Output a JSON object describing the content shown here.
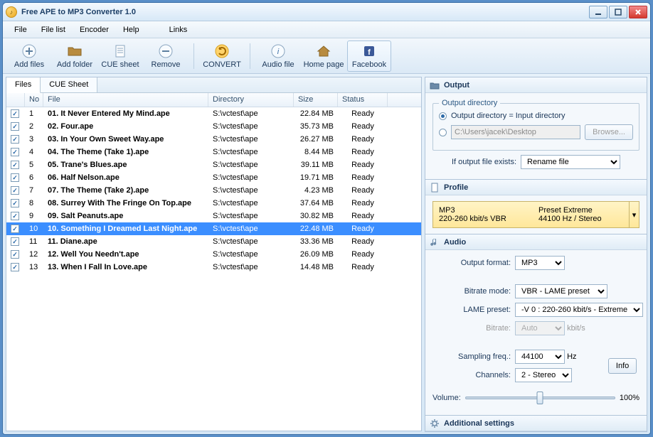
{
  "window": {
    "title": "Free APE to MP3 Converter 1.0"
  },
  "menubar": {
    "items": [
      "File",
      "File list",
      "Encoder",
      "Help"
    ],
    "right": [
      "Links"
    ]
  },
  "toolbar": {
    "add_files": "Add files",
    "add_folder": "Add folder",
    "cue_sheet": "CUE sheet",
    "remove": "Remove",
    "convert": "CONVERT",
    "audio_file": "Audio file",
    "home_page": "Home page",
    "facebook": "Facebook"
  },
  "tabs": {
    "files": "Files",
    "cue": "CUE Sheet"
  },
  "columns": {
    "no": "No",
    "file": "File",
    "dir": "Directory",
    "size": "Size",
    "status": "Status"
  },
  "rows": [
    {
      "no": "1",
      "file": "01. It Never Entered My Mind.ape",
      "dir": "S:\\vctest\\ape",
      "size": "22.84 MB",
      "status": "Ready",
      "chk": true,
      "sel": false
    },
    {
      "no": "2",
      "file": "02. Four.ape",
      "dir": "S:\\vctest\\ape",
      "size": "35.73 MB",
      "status": "Ready",
      "chk": true,
      "sel": false
    },
    {
      "no": "3",
      "file": "03. In Your Own Sweet Way.ape",
      "dir": "S:\\vctest\\ape",
      "size": "26.27 MB",
      "status": "Ready",
      "chk": true,
      "sel": false
    },
    {
      "no": "4",
      "file": "04. The Theme (Take 1).ape",
      "dir": "S:\\vctest\\ape",
      "size": "8.44 MB",
      "status": "Ready",
      "chk": true,
      "sel": false
    },
    {
      "no": "5",
      "file": "05. Trane's Blues.ape",
      "dir": "S:\\vctest\\ape",
      "size": "39.11 MB",
      "status": "Ready",
      "chk": true,
      "sel": false
    },
    {
      "no": "6",
      "file": "06. Half Nelson.ape",
      "dir": "S:\\vctest\\ape",
      "size": "19.71 MB",
      "status": "Ready",
      "chk": true,
      "sel": false
    },
    {
      "no": "7",
      "file": "07. The Theme (Take 2).ape",
      "dir": "S:\\vctest\\ape",
      "size": "4.23 MB",
      "status": "Ready",
      "chk": true,
      "sel": false
    },
    {
      "no": "8",
      "file": "08. Surrey With The Fringe On Top.ape",
      "dir": "S:\\vctest\\ape",
      "size": "37.64 MB",
      "status": "Ready",
      "chk": true,
      "sel": false
    },
    {
      "no": "9",
      "file": "09. Salt Peanuts.ape",
      "dir": "S:\\vctest\\ape",
      "size": "30.82 MB",
      "status": "Ready",
      "chk": true,
      "sel": false
    },
    {
      "no": "10",
      "file": "10. Something I Dreamed Last Night.ape",
      "dir": "S:\\vctest\\ape",
      "size": "22.48 MB",
      "status": "Ready",
      "chk": true,
      "sel": true
    },
    {
      "no": "11",
      "file": "11. Diane.ape",
      "dir": "S:\\vctest\\ape",
      "size": "33.36 MB",
      "status": "Ready",
      "chk": true,
      "sel": false
    },
    {
      "no": "12",
      "file": "12. Well You Needn't.ape",
      "dir": "S:\\vctest\\ape",
      "size": "26.09 MB",
      "status": "Ready",
      "chk": true,
      "sel": false
    },
    {
      "no": "13",
      "file": "13. When I Fall In Love.ape",
      "dir": "S:\\vctest\\ape",
      "size": "14.48 MB",
      "status": "Ready",
      "chk": true,
      "sel": false
    }
  ],
  "output": {
    "heading": "Output",
    "legend": "Output directory",
    "opt_same": "Output directory = Input directory",
    "path": "C:\\Users\\jacek\\Desktop",
    "browse": "Browse...",
    "if_exists_label": "If output file exists:",
    "if_exists": "Rename file"
  },
  "profile": {
    "heading": "Profile",
    "line1a": "MP3",
    "line1b": "Preset Extreme",
    "line2a": "220-260 kbit/s VBR",
    "line2b": "44100 Hz / Stereo"
  },
  "audio": {
    "heading": "Audio",
    "output_format_label": "Output format:",
    "output_format": "MP3",
    "bitrate_mode_label": "Bitrate mode:",
    "bitrate_mode": "VBR - LAME preset",
    "lame_preset_label": "LAME preset:",
    "lame_preset": "-V 0 : 220-260 kbit/s - Extreme",
    "bitrate_label": "Bitrate:",
    "bitrate": "Auto",
    "bitrate_unit": "kbit/s",
    "sampling_label": "Sampling freq.:",
    "sampling": "44100",
    "hz": "Hz",
    "channels_label": "Channels:",
    "channels": "2 - Stereo",
    "info": "Info",
    "volume_label": "Volume:",
    "volume_pct": "100%"
  },
  "additional": {
    "heading": "Additional settings"
  }
}
